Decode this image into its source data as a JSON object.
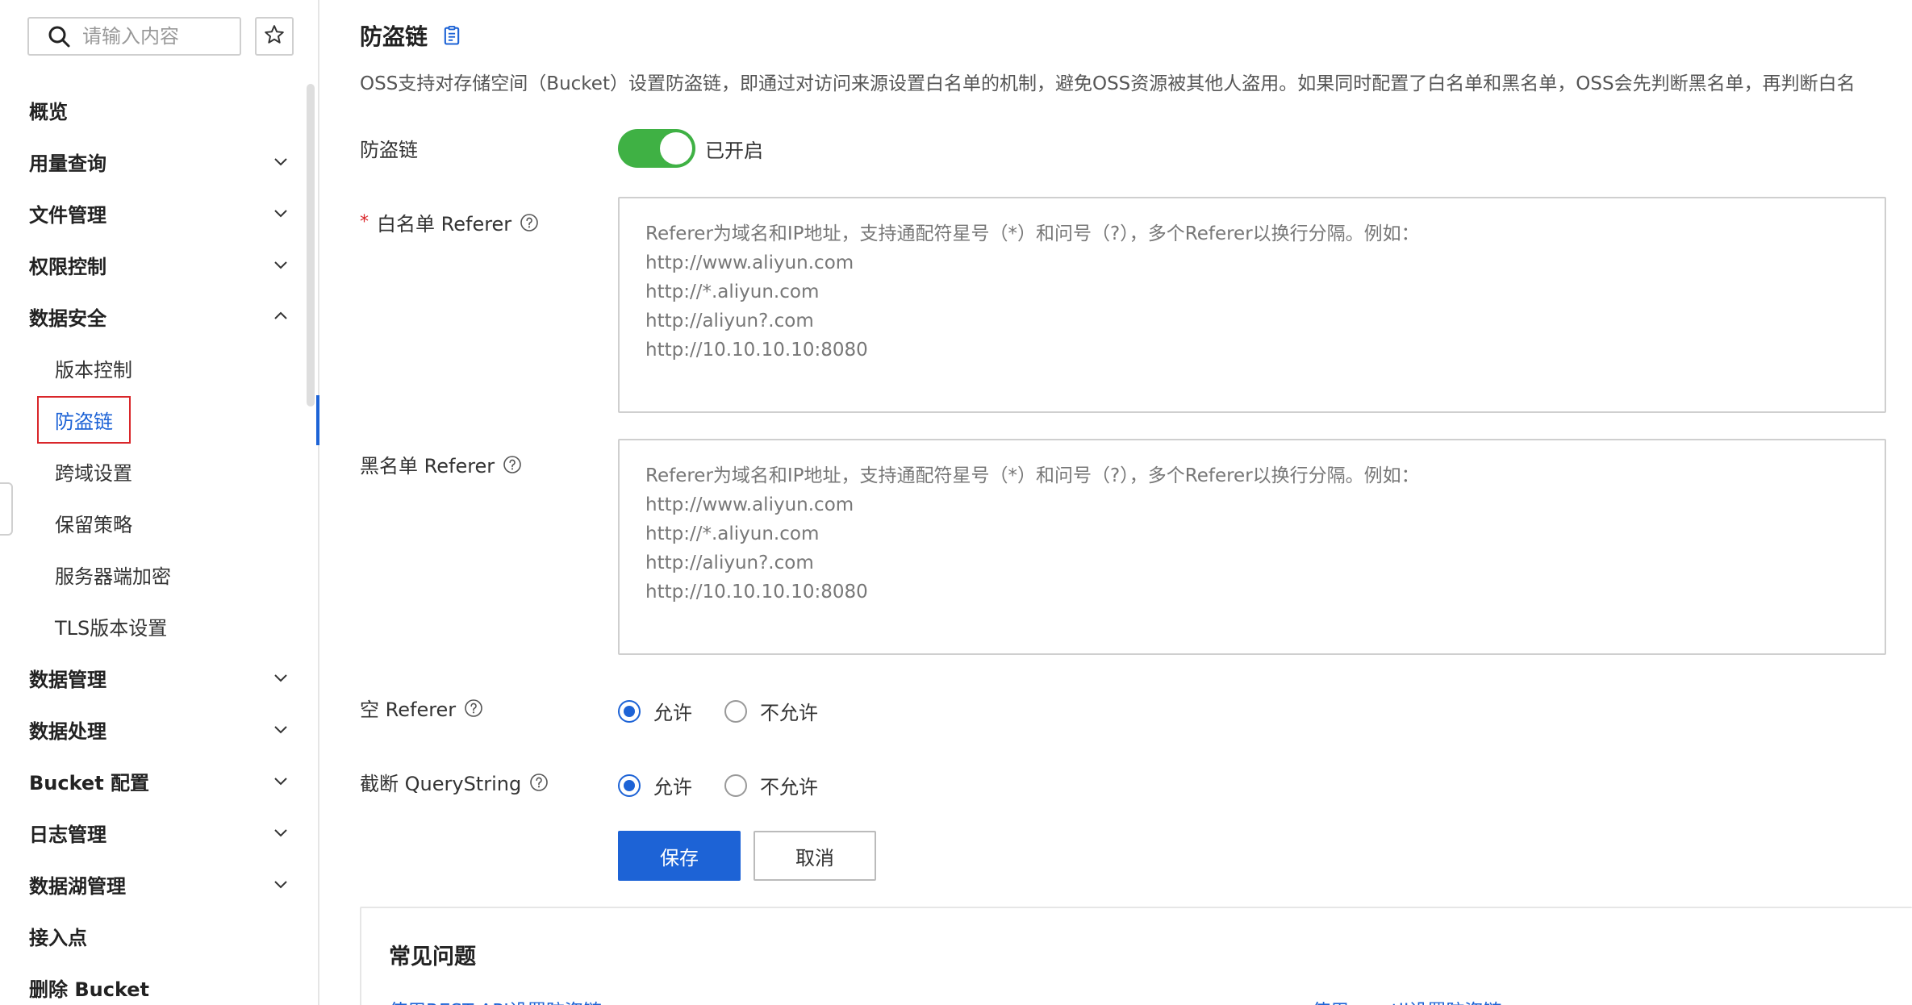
{
  "sidebar": {
    "search_placeholder": "请输入内容",
    "items": [
      {
        "label": "概览"
      },
      {
        "label": "用量查询"
      },
      {
        "label": "文件管理"
      },
      {
        "label": "权限控制"
      },
      {
        "label": "数据安全"
      },
      {
        "label": "版本控制"
      },
      {
        "label": "防盗链"
      },
      {
        "label": "跨域设置"
      },
      {
        "label": "保留策略"
      },
      {
        "label": "服务器端加密"
      },
      {
        "label": "TLS版本设置"
      },
      {
        "label": "数据管理"
      },
      {
        "label": "数据处理"
      },
      {
        "label": "Bucket 配置"
      },
      {
        "label": "日志管理"
      },
      {
        "label": "数据湖管理"
      },
      {
        "label": "接入点"
      },
      {
        "label": "删除 Bucket"
      }
    ]
  },
  "main": {
    "title": "防盗链",
    "description": "OSS支持对存储空间（Bucket）设置防盗链，即通过对访问来源设置白名单的机制，避免OSS资源被其他人盗用。如果同时配置了白名单和黑名单，OSS会先判断黑名单，再判断白名",
    "hotlink": {
      "label": "防盗链",
      "status": "已开启",
      "enabled": true
    },
    "whitelist": {
      "required_mark": "*",
      "label": "白名单 Referer",
      "placeholder": "Referer为域名和IP地址，支持通配符星号（*）和问号（?），多个Referer以换行分隔。例如：\nhttp://www.aliyun.com\nhttp://*.aliyun.com\nhttp://aliyun?.com\nhttp://10.10.10.10:8080"
    },
    "blacklist": {
      "label": "黑名单 Referer",
      "placeholder": "Referer为域名和IP地址，支持通配符星号（*）和问号（?），多个Referer以换行分隔。例如：\nhttp://www.aliyun.com\nhttp://*.aliyun.com\nhttp://aliyun?.com\nhttp://10.10.10.10:8080"
    },
    "empty_referer": {
      "label": "空 Referer",
      "options": [
        "允许",
        "不允许"
      ],
      "selected": "允许"
    },
    "truncate_querystring": {
      "label": "截断 QueryString",
      "options": [
        "允许",
        "不允许"
      ],
      "selected": "允许"
    },
    "buttons": {
      "save": "保存",
      "cancel": "取消"
    },
    "faq": {
      "title": "常见问题",
      "links": [
        "使用REST API设置防盗链",
        "使用ossutil设置防盗链"
      ]
    }
  },
  "colors": {
    "primary": "#1d63d6",
    "toggle_on": "#3fb144",
    "required": "#d9262a",
    "highlight_box": "#d9262a"
  }
}
